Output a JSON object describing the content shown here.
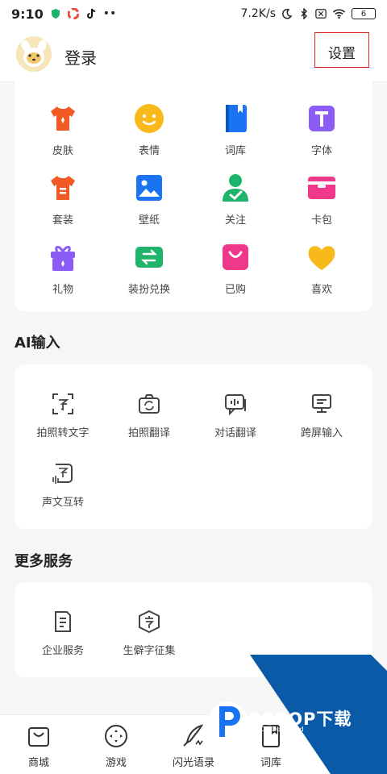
{
  "status_bar": {
    "time": "9:10",
    "network_speed": "7.2K/s",
    "battery": "6"
  },
  "header": {
    "login_label": "登录",
    "settings_label": "设置"
  },
  "top_grid": [
    {
      "label": "皮肤",
      "icon": "shirt-icon",
      "color": "#f15a24"
    },
    {
      "label": "表情",
      "icon": "smile-icon",
      "color": "#f9b91b"
    },
    {
      "label": "词库",
      "icon": "book-icon",
      "color": "#1a73f0"
    },
    {
      "label": "字体",
      "icon": "font-icon",
      "color": "#8b5cf6"
    },
    {
      "label": "套装",
      "icon": "suit-icon",
      "color": "#f15a24"
    },
    {
      "label": "壁纸",
      "icon": "image-icon",
      "color": "#1a73f0"
    },
    {
      "label": "关注",
      "icon": "follow-icon",
      "color": "#1fb46b"
    },
    {
      "label": "卡包",
      "icon": "card-icon",
      "color": "#f0388a"
    },
    {
      "label": "礼物",
      "icon": "gift-icon",
      "color": "#8b5cf6"
    },
    {
      "label": "装扮兑换",
      "icon": "exchange-icon",
      "color": "#1fb46b"
    },
    {
      "label": "已购",
      "icon": "bag-icon",
      "color": "#f0388a"
    },
    {
      "label": "喜欢",
      "icon": "heart-icon",
      "color": "#f9b91b"
    }
  ],
  "ai_section": {
    "title": "AI输入",
    "items": [
      {
        "label": "拍照转文字",
        "icon": "ocr-icon"
      },
      {
        "label": "拍照翻译",
        "icon": "camera-translate-icon"
      },
      {
        "label": "对话翻译",
        "icon": "dialog-translate-icon"
      },
      {
        "label": "跨屏输入",
        "icon": "screen-input-icon"
      },
      {
        "label": "声文互转",
        "icon": "voice-text-icon"
      }
    ]
  },
  "more_section": {
    "title": "更多服务",
    "items": [
      {
        "label": "企业服务",
        "icon": "enterprise-icon"
      },
      {
        "label": "生僻字征集",
        "icon": "rare-char-icon"
      }
    ]
  },
  "bottom_nav": [
    {
      "label": "商城",
      "icon": "shop-icon"
    },
    {
      "label": "游戏",
      "icon": "game-icon"
    },
    {
      "label": "闪光语录",
      "icon": "quill-icon"
    },
    {
      "label": "词库",
      "icon": "book-nav-icon"
    }
  ],
  "watermark": {
    "text": "PCPOP下载",
    "sub": "PCPOP Download",
    "color": "#0a5aa8"
  }
}
